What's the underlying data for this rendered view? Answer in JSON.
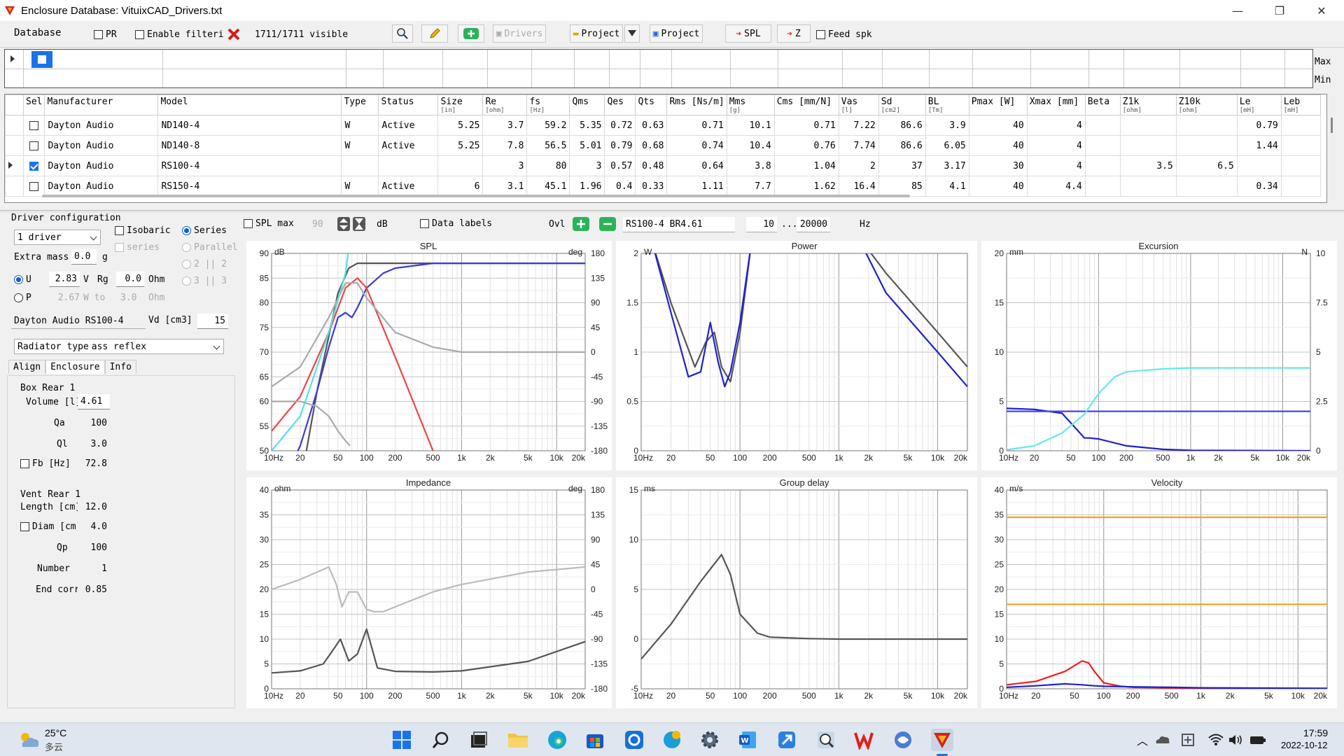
{
  "window": {
    "title": "Enclosure  Database: VituixCAD_Drivers.txt",
    "minimize": "—",
    "maximize": "❐",
    "close": "✕"
  },
  "toolbar": {
    "database": "Database",
    "pr": "PR",
    "enable_filtering": "Enable filteri",
    "visible": "1711/1711 visible",
    "drivers": "Drivers",
    "project_open": "Project",
    "project_save": "Project",
    "spl": "SPL",
    "z": "Z",
    "feed_spk": "Feed spk"
  },
  "filter": {
    "max": "Max",
    "min": "Min"
  },
  "table": {
    "columns": [
      "Sel",
      "Manufacturer",
      "Model",
      "Type",
      "Status",
      "Size\n[in]",
      "Re\n[ohm]",
      "fs\n[Hz]",
      "Qms",
      "Qes",
      "Qts",
      "Rms [Ns/m]",
      "Mms\n[g]",
      "Cms [mm/N]",
      "Vas\n[l]",
      "Sd\n[cm2]",
      "BL\n[Tm]",
      "Pmax [W]",
      "Xmax [mm]",
      "Beta",
      "Z1k\n[ohm]",
      "Z10k\n[ohm]",
      "Le\n[mH]",
      "Leb\n[mH]"
    ],
    "rows": [
      {
        "sel": false,
        "cur": false,
        "cells": [
          "Dayton Audio",
          "ND140-4",
          "W",
          "Active",
          "5.25",
          "3.7",
          "59.2",
          "5.35",
          "0.72",
          "0.63",
          "0.71",
          "10.1",
          "0.71",
          "7.22",
          "86.6",
          "3.9",
          "40",
          "4",
          "",
          "",
          "",
          "0.79",
          ""
        ]
      },
      {
        "sel": false,
        "cur": false,
        "cells": [
          "Dayton Audio",
          "ND140-8",
          "W",
          "Active",
          "5.25",
          "7.8",
          "56.5",
          "5.01",
          "0.79",
          "0.68",
          "0.74",
          "10.4",
          "0.76",
          "7.74",
          "86.6",
          "6.05",
          "40",
          "4",
          "",
          "",
          "",
          "1.44",
          ""
        ]
      },
      {
        "sel": true,
        "cur": true,
        "cells": [
          "Dayton Audio",
          "RS100-4",
          "",
          "",
          "",
          "3",
          "80",
          "3",
          "0.57",
          "0.48",
          "0.64",
          "3.8",
          "1.04",
          "2",
          "37",
          "3.17",
          "30",
          "4",
          "",
          "3.5",
          "6.5",
          "",
          ""
        ]
      },
      {
        "sel": false,
        "cur": false,
        "cells": [
          "Dayton Audio",
          "RS150-4",
          "W",
          "Active",
          "6",
          "3.1",
          "45.1",
          "1.96",
          "0.4",
          "0.33",
          "1.11",
          "7.7",
          "1.62",
          "16.4",
          "85",
          "4.1",
          "40",
          "4.4",
          "",
          "",
          "",
          "0.34",
          ""
        ]
      }
    ]
  },
  "driver_config": {
    "title": "Driver configuration",
    "count": "1 driver",
    "isobaric": "Isobaric",
    "series": "Series",
    "series2": "series",
    "parallel": "Parallel",
    "two": "2 || 2",
    "three": "3 || 3",
    "extra_mass_label": "Extra mass",
    "extra_mass": "0.0",
    "extra_mass_unit": "g",
    "u_label": "U",
    "u_value": "2.83",
    "u_unit": "V",
    "rg_label": "Rg",
    "rg_value": "0.0",
    "rg_unit": "Ohm",
    "p_label": "P",
    "p_value": "2.67",
    "p_unit": "W to",
    "p_ohm": "3.0",
    "p_ohm_unit": "Ohm",
    "driver_name": "Dayton Audio RS100-4",
    "vd_label": "Vd [cm3]",
    "vd_value": "15",
    "radiator_label": "Radiator type",
    "radiator_value": "ass reflex"
  },
  "tabs": [
    "Align",
    "Enclosure",
    "Info"
  ],
  "box": {
    "title": "Box Rear 1",
    "volume_label": "Volume [l]",
    "volume": "4.61",
    "qa_label": "Qa",
    "qa": "100",
    "ql_label": "Ql",
    "ql": "3.0",
    "fb_label": "Fb [Hz]",
    "fb": "72.8"
  },
  "vent": {
    "title": "Vent Rear 1",
    "length_label": "Length [cm]",
    "length": "12.0",
    "diam_label": "Diam [cm]",
    "diam": "4.0",
    "qp_label": "Qp",
    "qp": "100",
    "number_label": "Number",
    "number": "1",
    "endcorr_label": "End corr",
    "endcorr": "0.85"
  },
  "plotbar": {
    "spl_max": "SPL max",
    "spl_max_value": "90",
    "db": "dB",
    "data_labels": "Data labels",
    "ovl": "Ovl",
    "overlay_name": "RS100-4 BR4.61",
    "f_from": "10",
    "dots": "...",
    "f_to": "20000",
    "hz": "Hz"
  },
  "xticks": [
    "10Hz",
    "20",
    "50",
    "100",
    "200",
    "500",
    "1k",
    "2k",
    "5k",
    "10k",
    "20k"
  ],
  "chart_data": [
    {
      "type": "line",
      "title": "SPL",
      "ylabel": "dB",
      "y2label": "deg",
      "x_range": [
        10,
        20000
      ],
      "log_x": true,
      "ylim": [
        50,
        90
      ],
      "y2lim": [
        -180,
        180
      ],
      "yticks": [
        "90",
        "85",
        "80",
        "75",
        "70",
        "65",
        "60",
        "55",
        "50"
      ],
      "y2ticks": [
        "180",
        "135",
        "90",
        "45",
        "0",
        "-45",
        "-90",
        "-135",
        "-180"
      ],
      "series": [
        {
          "color": "#555555",
          "x": [
            10,
            20,
            30,
            50,
            65,
            80,
            100,
            150,
            200,
            500,
            1000,
            20000
          ],
          "y": [
            20,
            43,
            62,
            82,
            87,
            88,
            88,
            88,
            88,
            88,
            88,
            88
          ]
        },
        {
          "color": "#3b3bd6",
          "x": [
            10,
            20,
            30,
            40,
            50,
            60,
            70,
            80,
            100,
            150,
            200,
            500,
            1000,
            20000
          ],
          "y": [
            39,
            51,
            62,
            71,
            77,
            78,
            77,
            79,
            83,
            86,
            87,
            88,
            88,
            88
          ]
        },
        {
          "color": "#ef4444",
          "x": [
            10,
            20,
            40,
            60,
            80,
            100,
            200,
            500
          ],
          "y": [
            54,
            61,
            74,
            83,
            85,
            83,
            69,
            50
          ]
        },
        {
          "color": "#aaaaaa",
          "x": [
            10,
            20,
            40,
            60,
            80,
            100,
            200,
            500,
            1000,
            20000
          ],
          "y": [
            63,
            67,
            77,
            84,
            84,
            81,
            74,
            71,
            70,
            70
          ]
        },
        {
          "color": "#aaaaaa",
          "x": [
            10,
            20,
            30,
            40,
            50,
            60,
            67
          ],
          "y": [
            60,
            60,
            59,
            57,
            54,
            52,
            51
          ]
        },
        {
          "color": "#55e0e0",
          "x": [
            10,
            20,
            40,
            60,
            64,
            66
          ],
          "y": [
            50,
            57,
            74,
            86,
            90,
            91
          ]
        }
      ]
    },
    {
      "type": "line",
      "title": "Power",
      "ylabel": "W",
      "x_range": [
        10,
        20000
      ],
      "log_x": true,
      "ylim": [
        0,
        2
      ],
      "yticks": [
        "2",
        "1.5",
        "1",
        "0.5",
        "0"
      ],
      "series": [
        {
          "color": "#555555",
          "x": [
            13,
            20,
            35,
            45,
            55,
            65,
            80,
            100,
            130,
            160,
            1500,
            3000,
            10000,
            20000
          ],
          "y": [
            2.1,
            1.5,
            0.85,
            1.1,
            1.2,
            0.85,
            0.7,
            1.2,
            2.1,
            2.2,
            2.2,
            1.8,
            1.2,
            0.85
          ]
        },
        {
          "color": "#2020d0",
          "x": [
            13,
            20,
            30,
            40,
            50,
            60,
            70,
            80,
            100,
            130,
            160,
            1500,
            3000,
            10000,
            20000
          ],
          "y": [
            2.1,
            1.4,
            0.75,
            0.8,
            1.3,
            0.9,
            0.65,
            0.8,
            1.3,
            2.1,
            2.2,
            2.2,
            1.6,
            1.0,
            0.65
          ]
        }
      ]
    },
    {
      "type": "line",
      "title": "Excursion",
      "ylabel": "mm",
      "y2label": "N",
      "x_range": [
        10,
        20000
      ],
      "log_x": true,
      "ylim": [
        0,
        20
      ],
      "y2lim": [
        0,
        10
      ],
      "yticks": [
        "20",
        "15",
        "10",
        "5",
        "0"
      ],
      "y2ticks": [
        "10",
        "7.5",
        "5",
        "2.5",
        "0"
      ],
      "series": [
        {
          "color": "#2020d0",
          "x": [
            10,
            20,
            40,
            60,
            70,
            80,
            100,
            200,
            500,
            1000,
            20000
          ],
          "y": [
            4.3,
            4.2,
            3.8,
            2.0,
            1.3,
            1.3,
            1.2,
            0.5,
            0.15,
            0.05,
            0
          ]
        },
        {
          "color": "#4444ee",
          "x": [
            10,
            20000
          ],
          "y": [
            4.0,
            4.0
          ]
        },
        {
          "color": "#66e8e8",
          "x": [
            10,
            20,
            40,
            70,
            100,
            150,
            200,
            500,
            1000,
            20000
          ],
          "y": [
            0.1,
            0.5,
            1.8,
            3.7,
            5.8,
            7.5,
            8.0,
            8.3,
            8.4,
            8.4
          ]
        }
      ]
    },
    {
      "type": "line",
      "title": "Impedance",
      "ylabel": "ohm",
      "y2label": "deg",
      "x_range": [
        10,
        20000
      ],
      "log_x": true,
      "ylim": [
        0,
        40
      ],
      "y2lim": [
        -180,
        180
      ],
      "yticks": [
        "40",
        "35",
        "30",
        "25",
        "20",
        "15",
        "10",
        "5",
        "0"
      ],
      "y2ticks": [
        "180",
        "135",
        "90",
        "45",
        "0",
        "-45",
        "-90",
        "-135",
        "-180"
      ],
      "series": [
        {
          "color": "#555555",
          "x": [
            10,
            20,
            35,
            45,
            53,
            65,
            80,
            100,
            130,
            200,
            500,
            1000,
            5000,
            20000
          ],
          "y": [
            3.2,
            3.6,
            5,
            8,
            10,
            5.6,
            7,
            12,
            4.2,
            3.5,
            3.4,
            3.6,
            5.5,
            9.5
          ]
        },
        {
          "color": "#bbbbbb",
          "x": [
            10,
            20,
            40,
            48,
            55,
            65,
            80,
            100,
            120,
            150,
            200,
            500,
            1000,
            5000,
            20000
          ],
          "y": [
            20,
            22,
            24.5,
            21,
            16.5,
            19.5,
            19.5,
            16,
            15.5,
            15.5,
            16.5,
            19.5,
            21,
            23.5,
            24.5
          ]
        }
      ]
    },
    {
      "type": "line",
      "title": "Group delay",
      "ylabel": "ms",
      "x_range": [
        10,
        20000
      ],
      "log_x": true,
      "ylim": [
        -5,
        15
      ],
      "yticks": [
        "15",
        "10",
        "5",
        "0",
        "-5"
      ],
      "series": [
        {
          "color": "#555555",
          "x": [
            10,
            20,
            40,
            65,
            80,
            100,
            150,
            200,
            500,
            1000,
            20000
          ],
          "y": [
            -2,
            1.5,
            5.8,
            8.5,
            6.5,
            2.5,
            0.6,
            0.2,
            0.05,
            0,
            0
          ]
        }
      ]
    },
    {
      "type": "line",
      "title": "Velocity",
      "ylabel": "m/s",
      "x_range": [
        10,
        20000
      ],
      "log_x": true,
      "ylim": [
        0,
        40
      ],
      "yticks": [
        "40",
        "35",
        "30",
        "25",
        "20",
        "15",
        "10",
        "5",
        "0"
      ],
      "series": [
        {
          "color": "#f4a020",
          "x": [
            10,
            20000
          ],
          "y": [
            34.5,
            34.5
          ]
        },
        {
          "color": "#f4a020",
          "x": [
            10,
            20000
          ],
          "y": [
            17,
            17
          ]
        },
        {
          "color": "#ef2020",
          "x": [
            10,
            20,
            40,
            60,
            70,
            80,
            100,
            150,
            200,
            500,
            1000,
            20000
          ],
          "y": [
            0.8,
            1.5,
            3.5,
            5.6,
            5.2,
            3.5,
            1.2,
            0.5,
            0.3,
            0.2,
            0.1,
            0
          ]
        },
        {
          "color": "#2020d0",
          "x": [
            10,
            20,
            40,
            60,
            80,
            100,
            200,
            500,
            1000,
            20000
          ],
          "y": [
            0.3,
            0.6,
            1.0,
            0.8,
            0.6,
            0.5,
            0.4,
            0.3,
            0.2,
            0.1
          ]
        }
      ]
    }
  ],
  "taskbar": {
    "temp": "25°C",
    "weather": "多云",
    "time": "17:59",
    "date": "2022-10-12"
  }
}
